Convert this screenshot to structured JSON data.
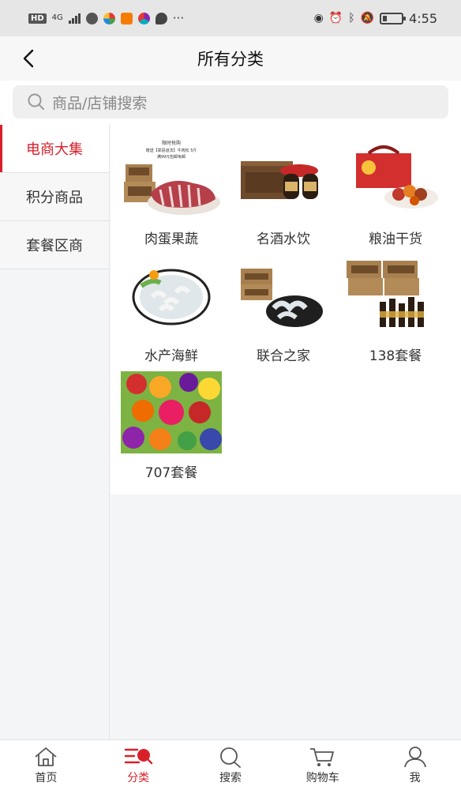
{
  "status_bar": {
    "hd_badge": "HD",
    "network_label": "4G",
    "more": "···",
    "time": "4:55",
    "battery_level_fraction": 0.2
  },
  "header": {
    "title": "所有分类",
    "back_icon": "chevron-left-icon"
  },
  "search": {
    "placeholder": "商品/店铺搜索",
    "icon": "search-icon"
  },
  "sidebar": {
    "items": [
      {
        "label": "电商大集",
        "active": true
      },
      {
        "label": "积分商品",
        "active": false
      },
      {
        "label": "套餐区商",
        "active": false
      }
    ]
  },
  "categories": [
    {
      "label": "肉蛋果蔬",
      "image": "meat-gift-box-image",
      "image_text": [
        "限时抢购",
        "赠送【郑县道法】牛肉松 5斤",
        "满99元包邮免邮"
      ]
    },
    {
      "label": "名酒水饮",
      "image": "liquor-gift-box-image"
    },
    {
      "label": "粮油干货",
      "image": "dried-goods-gift-box-image"
    },
    {
      "label": "水产海鲜",
      "image": "shrimp-plate-image"
    },
    {
      "label": "联合之家",
      "image": "shrimp-box-image"
    },
    {
      "label": "138套餐",
      "image": "boxes-and-bottles-image"
    },
    {
      "label": "707套餐",
      "image": "fruits-vegetables-image"
    }
  ],
  "tabbar": {
    "items": [
      {
        "label": "首页",
        "icon": "home-icon",
        "active": false
      },
      {
        "label": "分类",
        "icon": "category-icon",
        "active": true
      },
      {
        "label": "搜索",
        "icon": "search-icon",
        "active": false
      },
      {
        "label": "购物车",
        "icon": "cart-icon",
        "active": false
      },
      {
        "label": "我",
        "icon": "user-icon",
        "active": false
      }
    ]
  },
  "colors": {
    "accent": "#d9202a",
    "background": "#f4f5f7"
  }
}
